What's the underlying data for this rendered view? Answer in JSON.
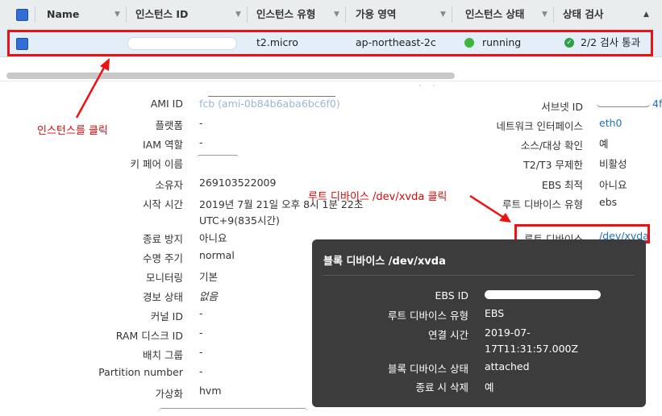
{
  "table": {
    "headers": {
      "name": "Name",
      "instance_id": "인스턴스 ID",
      "instance_type": "인스턴스 유형",
      "az": "가용 영역",
      "state": "인스턴스 상태",
      "status_check": "상태 검사"
    },
    "row": {
      "instance_type": "t2.micro",
      "az": "ap-northeast-2c",
      "state": "running",
      "status_check": "2/2 검사 통과"
    }
  },
  "annotations": {
    "click_instance": "인스턴스를 클릭",
    "click_root_device": "루트 디바이스  /dev/xvda 클릭"
  },
  "details_left": [
    {
      "label": "AMI ID",
      "value": ""
    },
    {
      "label": "플랫폼",
      "value": "-"
    },
    {
      "label": "IAM 역할",
      "value": "-"
    },
    {
      "label": "키 페어 이름",
      "value": ""
    },
    {
      "label": "소유자",
      "value": "269103522009"
    },
    {
      "label": "시작 시간",
      "value": "2019년 7월 21일 오후 8시 1분 22초",
      "value2": "UTC+9(835시간)"
    },
    {
      "label": "종료 방지",
      "value": "아니요"
    },
    {
      "label": "수명 주기",
      "value": "normal"
    },
    {
      "label": "모니터링",
      "value": "기본"
    },
    {
      "label": "경보 상태",
      "value": "없음"
    },
    {
      "label": "커널 ID",
      "value": "-"
    },
    {
      "label": "RAM 디스크 ID",
      "value": "-"
    },
    {
      "label": "배치 그룹",
      "value": "-"
    },
    {
      "label": "Partition number",
      "value": "-"
    },
    {
      "label": "가상화",
      "value": "hvm"
    }
  ],
  "details_right": [
    {
      "label": "서브넷 ID",
      "value": "4f"
    },
    {
      "label": "네트워크 인터페이스",
      "value": "eth0"
    },
    {
      "label": "소스/대상 확인",
      "value": "예"
    },
    {
      "label": "T2/T3 무제한",
      "value": "비활성"
    },
    {
      "label": "EBS 최적",
      "value": "아니요"
    },
    {
      "label": "루트 디바이스 유형",
      "value": "ebs"
    },
    {
      "label": "루트 디바이스",
      "value": "/dev/xvda"
    }
  ],
  "popover": {
    "title": "블록 디바이스 /dev/xvda",
    "rows": [
      {
        "label": "EBS ID",
        "value": ""
      },
      {
        "label": "루트 디바이스 유형",
        "value": "EBS"
      },
      {
        "label": "연결 시간",
        "value": "2019-07-",
        "value2": "17T11:31:57.000Z"
      },
      {
        "label": "블록 디바이스 상태",
        "value": "attached"
      },
      {
        "label": "종료 시 삭제",
        "value": "예"
      }
    ]
  },
  "colors": {
    "annotation_red": "#e11111",
    "link_blue": "#1f6fbf",
    "running_green": "#3cb53c",
    "popover_bg": "#3c3c3c"
  }
}
